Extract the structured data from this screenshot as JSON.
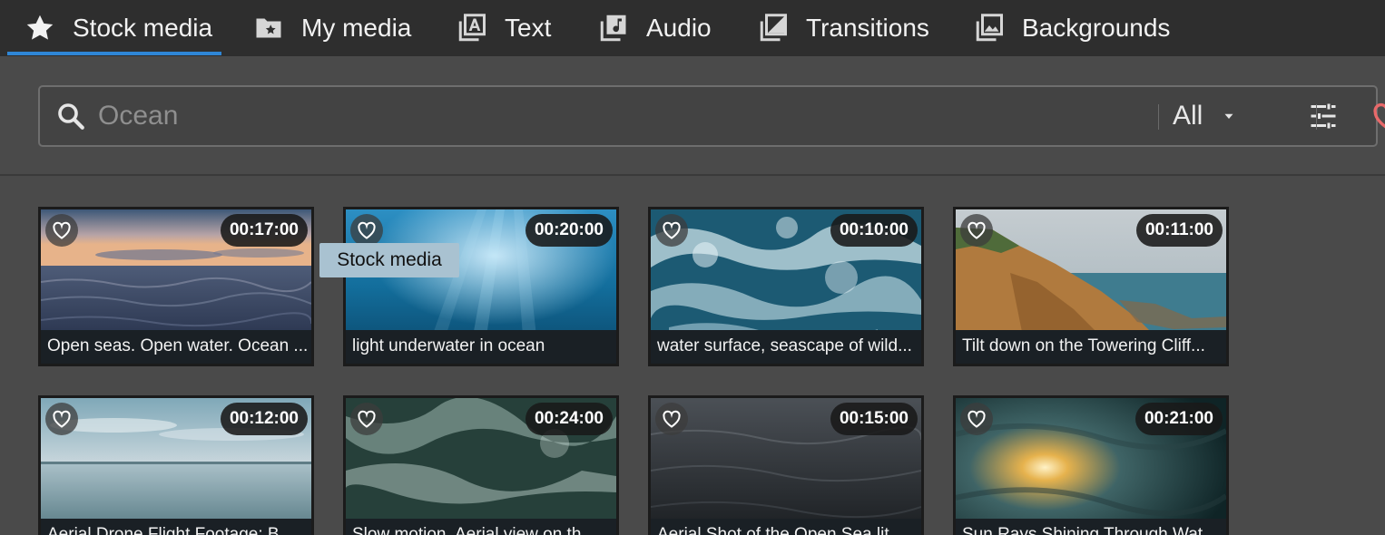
{
  "tabs": [
    {
      "label": "Stock media",
      "icon": "star-icon",
      "active": true
    },
    {
      "label": "My media",
      "icon": "folder-star-icon",
      "active": false
    },
    {
      "label": "Text",
      "icon": "text-icon",
      "active": false
    },
    {
      "label": "Audio",
      "icon": "music-note-icon",
      "active": false
    },
    {
      "label": "Transitions",
      "icon": "transition-icon",
      "active": false
    },
    {
      "label": "Backgrounds",
      "icon": "image-stack-icon",
      "active": false
    }
  ],
  "search": {
    "placeholder": "Ocean",
    "type_filter": "All"
  },
  "colors": {
    "accent": "#2f86d6",
    "favorite": "#e8696a",
    "tab_bar": "#2e2e2e",
    "panel": "#4a4a4a"
  },
  "tooltip": "Stock media",
  "media": [
    {
      "duration": "00:17:00",
      "title": "Open seas. Open water. Ocean ..."
    },
    {
      "duration": "00:20:00",
      "title": "light underwater in ocean"
    },
    {
      "duration": "00:10:00",
      "title": "water surface, seascape of wild..."
    },
    {
      "duration": "00:11:00",
      "title": "Tilt down on the Towering Cliff..."
    },
    {
      "duration": "00:12:00",
      "title": "Aerial Drone Flight Footage: B..."
    },
    {
      "duration": "00:24:00",
      "title": "Slow motion. Aerial view on th..."
    },
    {
      "duration": "00:15:00",
      "title": "Aerial Shot of the Open Sea lit..."
    },
    {
      "duration": "00:21:00",
      "title": "Sun Rays Shining Through Wat..."
    }
  ]
}
